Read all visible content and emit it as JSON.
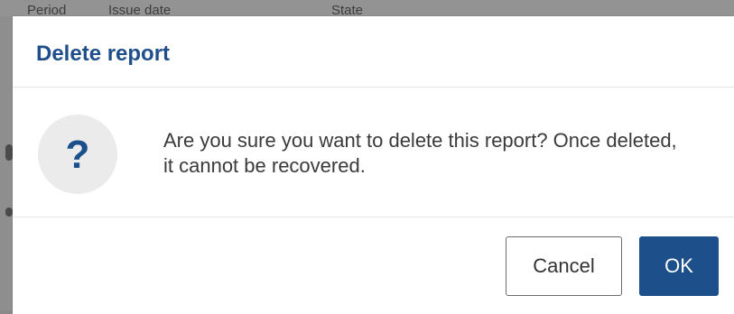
{
  "background": {
    "columns": [
      "Period",
      "Issue date",
      "State"
    ]
  },
  "dialog": {
    "title": "Delete report",
    "icon": "question-icon",
    "icon_glyph": "?",
    "message": "Are you sure you want to delete this report? Once deleted, it cannot be recovered.",
    "buttons": {
      "cancel_label": "Cancel",
      "ok_label": "OK"
    }
  },
  "colors": {
    "accent": "#1d4f8b",
    "title": "#1f4f8a",
    "icon_bg": "#ebebeb",
    "overlay": "#8e8e8e"
  }
}
